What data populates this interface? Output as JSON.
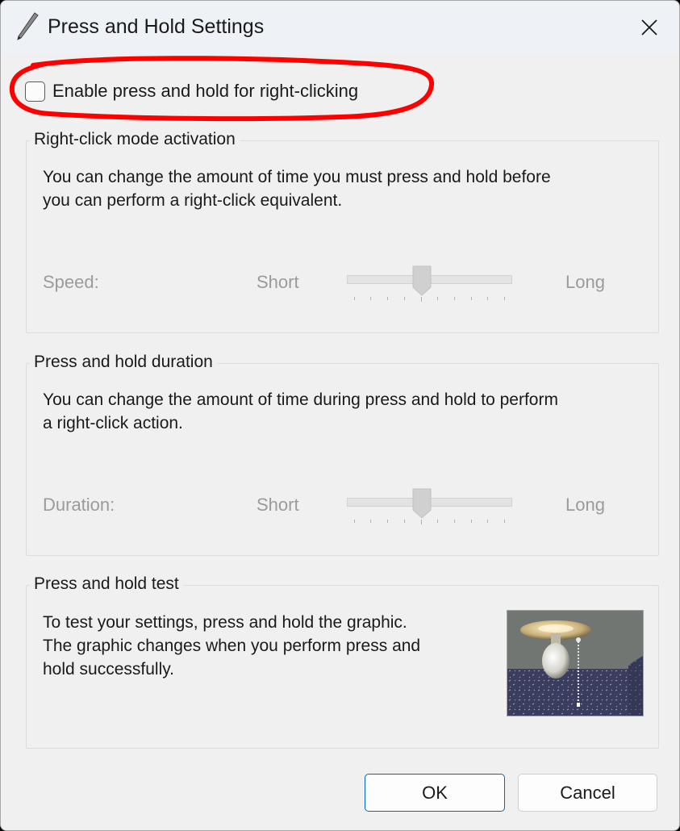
{
  "window": {
    "title": "Press and Hold Settings",
    "icon": "pen-icon",
    "close_icon": "close-icon"
  },
  "enable_checkbox": {
    "label": "Enable press and hold for right-clicking",
    "checked": false,
    "annotation_color": "#ff0000"
  },
  "activation": {
    "legend": "Right-click mode activation",
    "description": [
      "You can change the amount of time you must press and hold before",
      "you can perform a right-click equivalent."
    ],
    "slider_label": "Speed:",
    "min_label": "Short",
    "max_label": "Long",
    "value_fraction": 0.45,
    "enabled": false
  },
  "duration": {
    "legend": "Press and hold duration",
    "description": [
      "You can change the amount of time during press and hold to perform",
      "a right-click action."
    ],
    "slider_label": "Duration:",
    "min_label": "Short",
    "max_label": "Long",
    "value_fraction": 0.45,
    "enabled": false
  },
  "test": {
    "legend": "Press and hold test",
    "description": [
      "To test your settings, press and hold the graphic.",
      "The graphic changes when you perform press and",
      "hold successfully."
    ],
    "graphic_icon": "light-bulb-icon"
  },
  "buttons": {
    "ok": "OK",
    "cancel": "Cancel"
  },
  "colors": {
    "accent": "#0067c0",
    "disabled_text": "#9b9b9b"
  }
}
